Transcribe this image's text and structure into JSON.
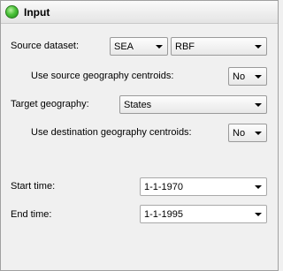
{
  "header": {
    "title": "Input",
    "status_icon": "green-circle-icon",
    "status_color": "#4cc23a"
  },
  "source_dataset": {
    "label": "Source dataset:",
    "dataset_value": "SEA",
    "method_value": "RBF"
  },
  "use_source_centroids": {
    "label": "Use source geography centroids:",
    "value": "No"
  },
  "target_geography": {
    "label": "Target geography:",
    "value": "States"
  },
  "use_destination_centroids": {
    "label": "Use destination geography centroids:",
    "value": "No"
  },
  "start_time": {
    "label": "Start time:",
    "value": "1-1-1970"
  },
  "end_time": {
    "label": "End time:",
    "value": "1-1-1995"
  }
}
